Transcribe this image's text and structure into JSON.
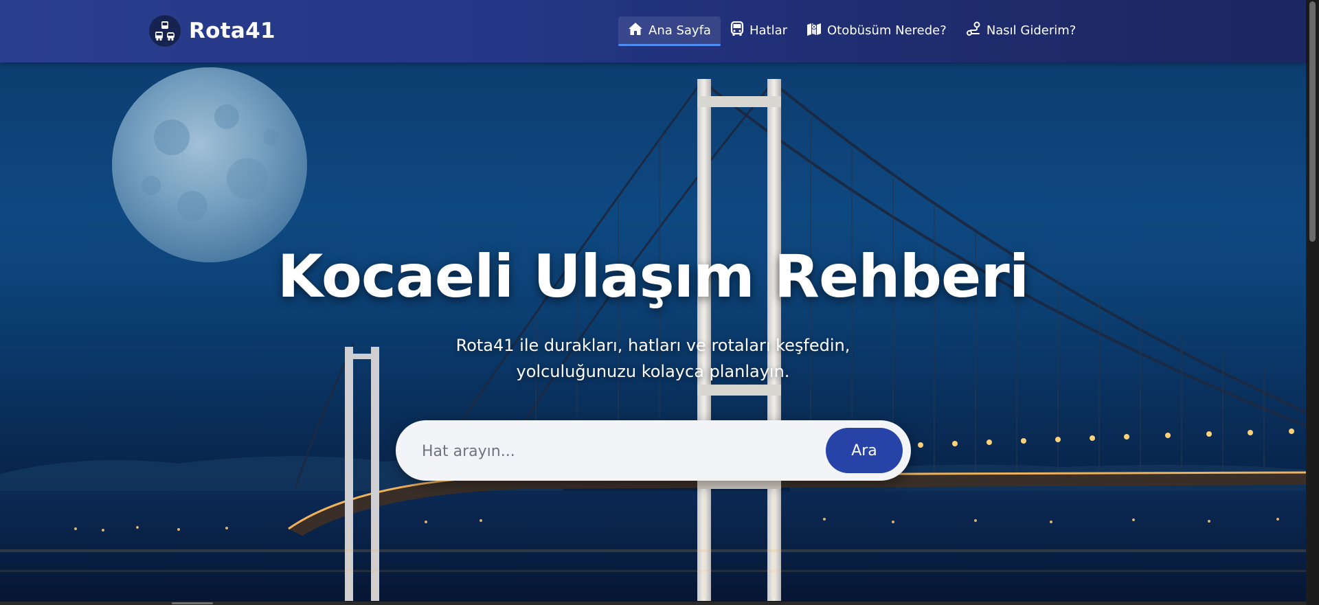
{
  "brand": {
    "name": "Rota41",
    "logo_icon": "transit-icon"
  },
  "nav": {
    "items": [
      {
        "label": "Ana Sayfa",
        "icon": "home-icon",
        "active": true
      },
      {
        "label": "Hatlar",
        "icon": "bus-icon",
        "active": false
      },
      {
        "label": "Otobüsüm Nerede?",
        "icon": "map-location-icon",
        "active": false
      },
      {
        "label": "Nasıl Giderim?",
        "icon": "route-icon",
        "active": false
      }
    ]
  },
  "hero": {
    "title": "Kocaeli Ulaşım Rehberi",
    "subtitle_line1": "Rota41 ile durakları, hatları ve rotaları keşfedin,",
    "subtitle_line2": "yolculuğunuzu kolayca planlayın.",
    "background": "night-bridge-with-full-moon"
  },
  "search": {
    "placeholder": "Hat arayın...",
    "value": "",
    "button_label": "Ara"
  },
  "colors": {
    "navbar": "#243685",
    "accent": "#2743a8",
    "active_underline": "#4f8df5",
    "search_bg": "#f3f4f8"
  }
}
